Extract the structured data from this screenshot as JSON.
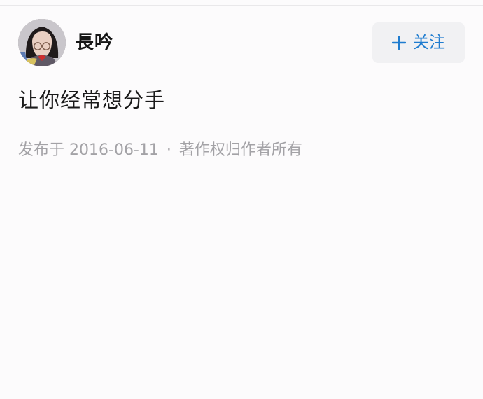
{
  "author": {
    "name": "長吟"
  },
  "follow": {
    "label": "关注",
    "icon": "plus-icon"
  },
  "post": {
    "text": "让你经常想分手",
    "published_prefix": "发布于",
    "date": "2016-06-11",
    "separator": "·",
    "copyright": "著作权归作者所有"
  },
  "colors": {
    "background": "#fcfbfc",
    "accent": "#1f7ccf",
    "meta_text": "#a3a2a6",
    "button_bg": "#f1f1f3"
  }
}
